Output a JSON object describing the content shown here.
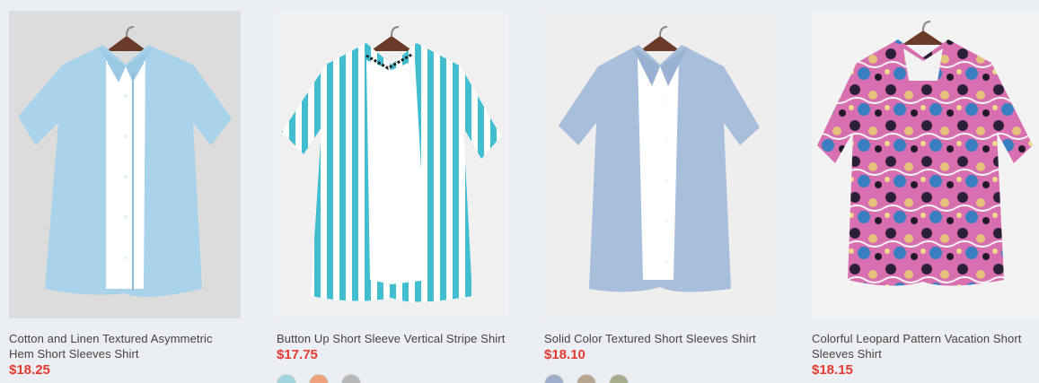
{
  "products": [
    {
      "title": "Cotton and Linen Textured Asymmetric Hem Short Sleeves Shirt",
      "price": "$18.25",
      "image_alt": "light blue shirt",
      "swatch_colors": []
    },
    {
      "title": "Button Up Short Sleeve Vertical Stripe Shirt",
      "price": "$17.75",
      "image_alt": "striped shirt",
      "swatch_colors": [
        "#9fd6e0",
        "#f0a07a",
        "#b8b8b8"
      ]
    },
    {
      "title": "Solid Color Textured Short Sleeves Shirt",
      "price": "$18.10",
      "image_alt": "blue shirt",
      "swatch_colors": [
        "#9eaecb",
        "#b7a58f",
        "#a7ad8c"
      ]
    },
    {
      "title": "Colorful Leopard Pattern Vacation Short Sleeves Shirt",
      "price": "$18.15",
      "image_alt": "leopard shirt",
      "swatch_colors": []
    }
  ],
  "colors": {
    "price": "#e53a31",
    "title": "#444444",
    "page_bg": "#ebeef2"
  }
}
